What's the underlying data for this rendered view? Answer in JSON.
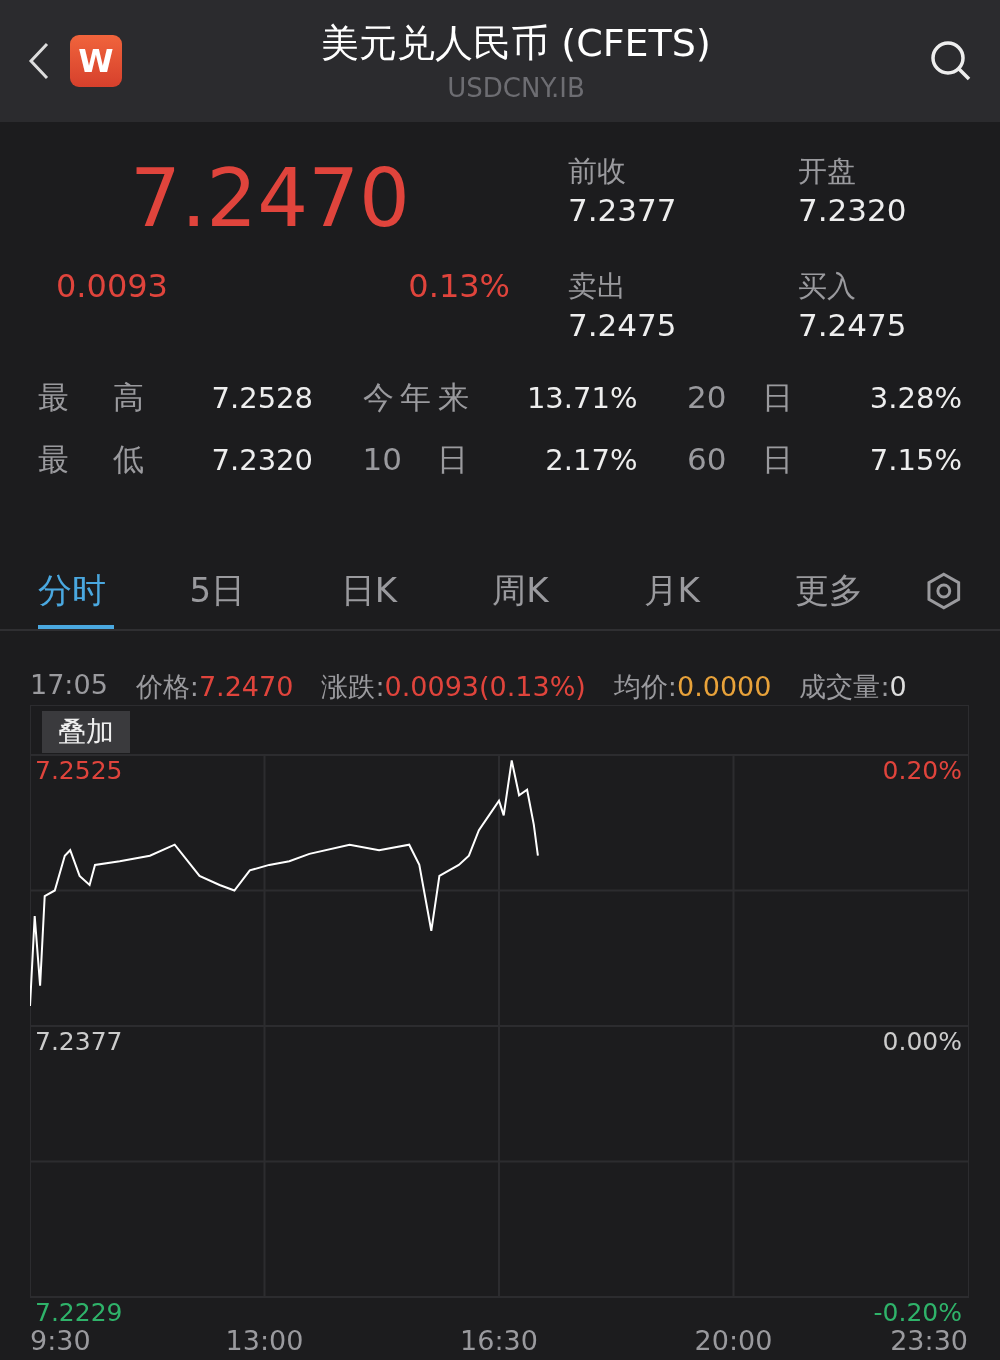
{
  "header": {
    "logo": "W",
    "title": "美元兑人民币 (CFETS)",
    "subtitle": "USDCNY.IB"
  },
  "quote": {
    "price": "7.2470",
    "change": "0.0093",
    "change_pct": "0.13%",
    "fields": [
      {
        "label": "前收",
        "value": "7.2377"
      },
      {
        "label": "开盘",
        "value": "7.2320"
      },
      {
        "label": "卖出",
        "value": "7.2475"
      },
      {
        "label": "买入",
        "value": "7.2475"
      }
    ]
  },
  "stats": [
    {
      "label": "最 高",
      "value": "7.2528"
    },
    {
      "label": "今年来",
      "value": "13.71%"
    },
    {
      "label": "20 日",
      "value": "3.28%"
    },
    {
      "label": "最 低",
      "value": "7.2320"
    },
    {
      "label": "10 日",
      "value": "2.17%"
    },
    {
      "label": "60 日",
      "value": "7.15%"
    }
  ],
  "tabs": [
    {
      "label": "分时",
      "selected": true
    },
    {
      "label": "5日",
      "selected": false
    },
    {
      "label": "日K",
      "selected": false
    },
    {
      "label": "周K",
      "selected": false
    },
    {
      "label": "月K",
      "selected": false
    },
    {
      "label": "更多",
      "selected": false
    }
  ],
  "info": {
    "time": "17:05",
    "items": [
      {
        "label": "价格:",
        "value": "7.2470",
        "color": "#e0443c"
      },
      {
        "label": "涨跌:",
        "value": "0.0093(0.13%)",
        "color": "#e0443c"
      },
      {
        "label": "均价:",
        "value": "0.0000",
        "color": "#e8a23a"
      },
      {
        "label": "成交量:",
        "value": "0",
        "color": "#dddddd"
      }
    ]
  },
  "overlay_button": "叠加",
  "chart": {
    "right_labels": [
      "0.20%",
      "0.00%",
      "-0.20%"
    ],
    "chart_data": {
      "type": "line",
      "x": [
        9.5,
        9.57,
        9.65,
        9.72,
        9.87,
        10.02,
        10.1,
        10.24,
        10.39,
        10.47,
        10.84,
        11.29,
        11.66,
        12.03,
        12.33,
        12.55,
        12.78,
        13.07,
        13.37,
        13.67,
        14.27,
        14.71,
        15.16,
        15.31,
        15.49,
        15.61,
        15.9,
        16.05,
        16.2,
        16.35,
        16.5,
        16.57,
        16.69,
        16.8,
        16.92,
        17.02,
        17.08
      ],
      "series": [
        {
          "color": "#ffffff",
          "values": [
            7.2388,
            7.2437,
            7.2399,
            7.2448,
            7.2451,
            7.247,
            7.2473,
            7.2459,
            7.2454,
            7.2465,
            7.2467,
            7.247,
            7.2476,
            7.2459,
            7.2454,
            7.2451,
            7.2462,
            7.2465,
            7.2467,
            7.2471,
            7.2476,
            7.2473,
            7.2476,
            7.2465,
            7.2429,
            7.2459,
            7.2465,
            7.247,
            7.2484,
            7.2492,
            7.25,
            7.2492,
            7.2522,
            7.2503,
            7.2506,
            7.2487,
            7.247
          ]
        }
      ],
      "grid": true,
      "xlim": [
        9.5,
        23.5
      ],
      "ylim": [
        7.2229,
        7.2525
      ],
      "xticks": [
        {
          "value": 9.5,
          "label": "9:30"
        },
        {
          "value": 13,
          "label": "13:00"
        },
        {
          "value": 16.5,
          "label": "16:30"
        },
        {
          "value": 20,
          "label": "20:00"
        },
        {
          "value": 23.5,
          "label": "23:30"
        }
      ],
      "yticks": [
        {
          "value": 7.2525,
          "label": "7.2525"
        },
        {
          "value": 7.2377,
          "label": "7.2377"
        },
        {
          "value": 7.2229,
          "label": "7.2229"
        }
      ]
    }
  }
}
